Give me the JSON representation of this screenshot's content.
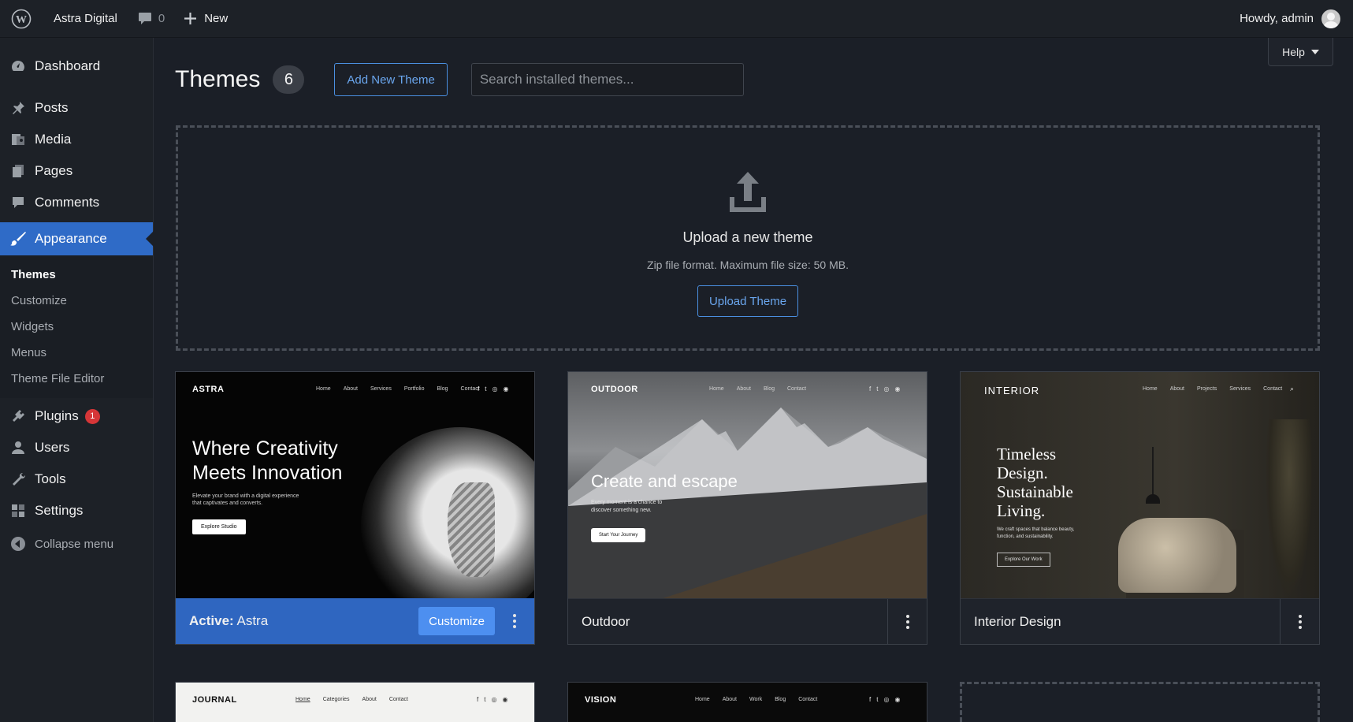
{
  "adminbar": {
    "site_name": "Astra Digital",
    "comments_count": "0",
    "new_label": "New",
    "howdy": "Howdy, admin"
  },
  "sidebar": {
    "items": [
      {
        "label": "Dashboard",
        "icon": "dashboard-icon"
      },
      {
        "label": "Posts",
        "icon": "pin-icon"
      },
      {
        "label": "Media",
        "icon": "media-icon"
      },
      {
        "label": "Pages",
        "icon": "pages-icon"
      },
      {
        "label": "Comments",
        "icon": "comment-icon"
      },
      {
        "label": "Appearance",
        "icon": "brush-icon"
      }
    ],
    "submenu": [
      "Themes",
      "Customize",
      "Widgets",
      "Menus",
      "Theme File Editor"
    ],
    "lower_items": [
      {
        "label": "Plugins",
        "icon": "plugin-icon",
        "badge": "1"
      },
      {
        "label": "Users",
        "icon": "user-icon"
      },
      {
        "label": "Tools",
        "icon": "wrench-icon"
      },
      {
        "label": "Settings",
        "icon": "settings-icon"
      }
    ],
    "collapse_label": "Collapse menu"
  },
  "header": {
    "help_label": "Help",
    "title": "Themes",
    "count": "6",
    "add_new_label": "Add New Theme",
    "search_placeholder": "Search installed themes..."
  },
  "upload": {
    "title": "Upload a new theme",
    "subtitle": "Zip file format. Maximum file size: 50 MB.",
    "button_label": "Upload Theme"
  },
  "themes": [
    {
      "name": "Astra",
      "active_prefix": "Active:",
      "customize_label": "Customize",
      "brand": "ASTRA",
      "nav": [
        "Home",
        "About",
        "Services",
        "Portfolio",
        "Blog",
        "Contact"
      ],
      "headline_1": "Where Creativity",
      "headline_2": "Meets Innovation",
      "body_1": "Elevate your brand with a digital experience",
      "body_2": "that captivates and converts.",
      "cta": "Explore Studio"
    },
    {
      "name": "Outdoor",
      "brand": "OUTDOOR",
      "nav": [
        "Home",
        "About",
        "Blog",
        "Contact"
      ],
      "headline_1": "Create and escape",
      "body_1": "Every moment is a chance to",
      "body_2": "discover something new.",
      "cta": "Start Your Journey"
    },
    {
      "name": "Interior Design",
      "brand": "INTERIOR",
      "nav": [
        "Home",
        "About",
        "Projects",
        "Services",
        "Contact"
      ],
      "headline_1": "Timeless",
      "headline_2": "Design.",
      "headline_3": "Sustainable",
      "headline_4": "Living.",
      "body_1": "We craft spaces that balance beauty,",
      "body_2": "function, and sustainability.",
      "cta": "Explore Our Work"
    },
    {
      "brand": "JOURNAL",
      "nav": [
        "Home",
        "Categories",
        "About",
        "Contact"
      ]
    },
    {
      "brand": "VISION",
      "nav": [
        "Home",
        "About",
        "Work",
        "Blog",
        "Contact"
      ]
    }
  ],
  "colors": {
    "accent": "#2f6bc7",
    "button_primary": "#4d8ff0",
    "badge": "#d63638"
  }
}
